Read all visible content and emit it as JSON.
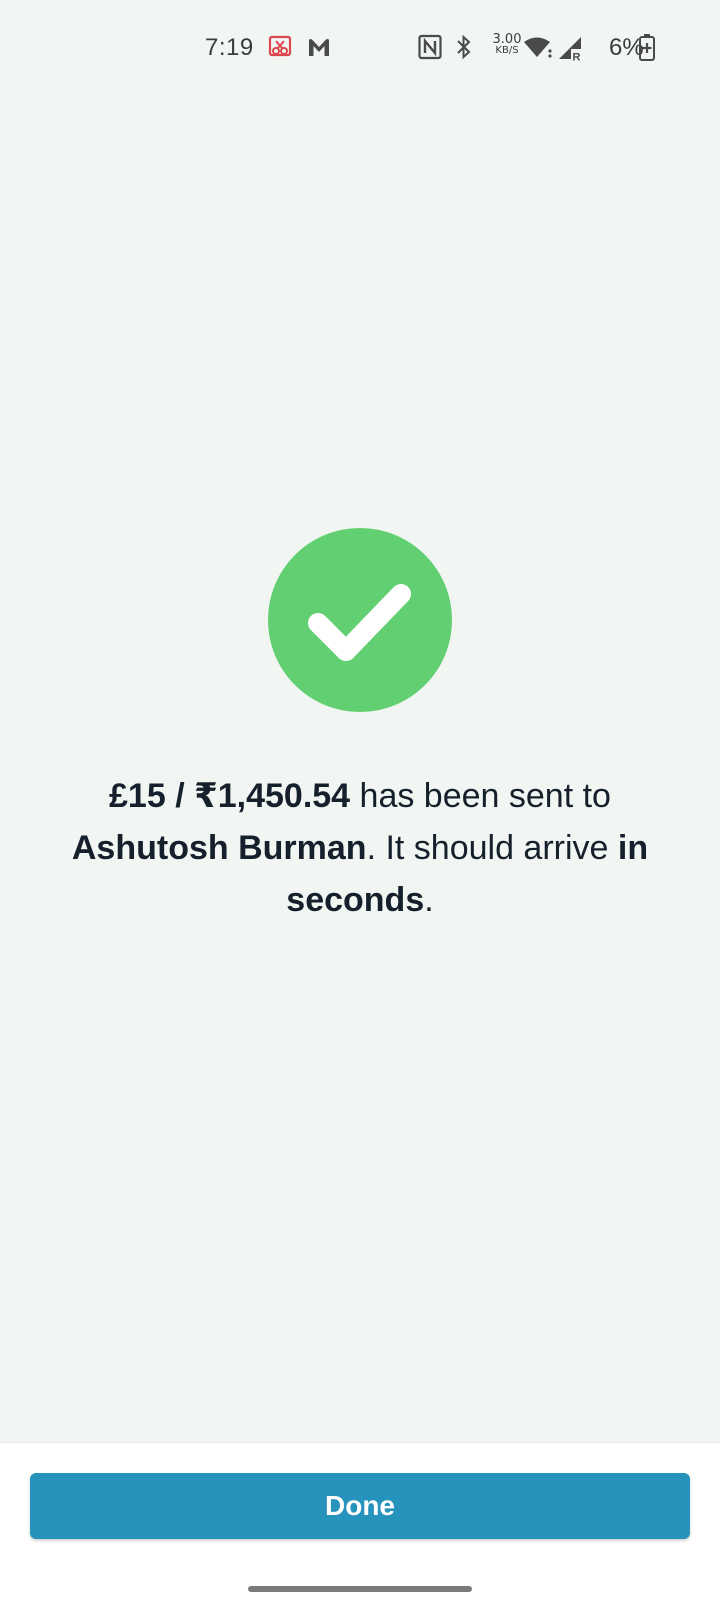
{
  "status_bar": {
    "time": "7:19",
    "network_speed_value": "3.00",
    "network_speed_unit": "KB/S",
    "battery_percent": "6%",
    "icons": [
      "screenshot-icon",
      "gmail-icon",
      "nfc-icon",
      "bluetooth-icon",
      "wifi-icon",
      "signal-icon",
      "battery-charging-icon"
    ],
    "signal_roaming_label": "R"
  },
  "success": {
    "icon": "checkmark-icon",
    "circle_color": "#63cf73",
    "amount": "£15 / ₹1,450.54",
    "text_sent_to": " has been sent to ",
    "recipient": "Ashutosh Burman",
    "text_arrive": ". It should arrive ",
    "arrival_time": "in seconds",
    "text_end": "."
  },
  "footer": {
    "done_label": "Done",
    "button_color": "#2593bc"
  }
}
